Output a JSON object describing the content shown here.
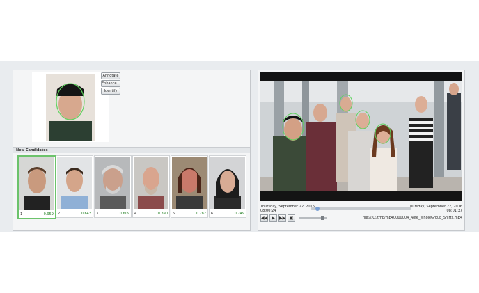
{
  "left_panel": {
    "buttons": {
      "annotate": "Annotate",
      "enhance": "Enhance...",
      "identify": "Identify"
    },
    "candidates_title": "New Candidates",
    "candidates": [
      {
        "rank": "1",
        "score": "0.959",
        "selected": true
      },
      {
        "rank": "2",
        "score": "0.643",
        "selected": false
      },
      {
        "rank": "3",
        "score": "0.609",
        "selected": false
      },
      {
        "rank": "4",
        "score": "0.390",
        "selected": false
      },
      {
        "rank": "5",
        "score": "0.282",
        "selected": false
      },
      {
        "rank": "6",
        "score": "0.249",
        "selected": false
      }
    ]
  },
  "right_panel": {
    "start_date": "Thursday, September 22, 2016",
    "start_time": "08:00:24",
    "end_date": "Thursday, September 22, 2016",
    "end_time": "08:01:37",
    "playhead_fraction": 0.07,
    "controls": [
      "prev-icon",
      "play-icon",
      "next-icon",
      "snapshot-icon"
    ],
    "file_path": "file:///C:/tmp/mp40000004_Aofe_WholeGroup_Shirts.mp4"
  },
  "colors": {
    "match_green": "#6cc36c",
    "score_green": "#1e7d1e"
  }
}
